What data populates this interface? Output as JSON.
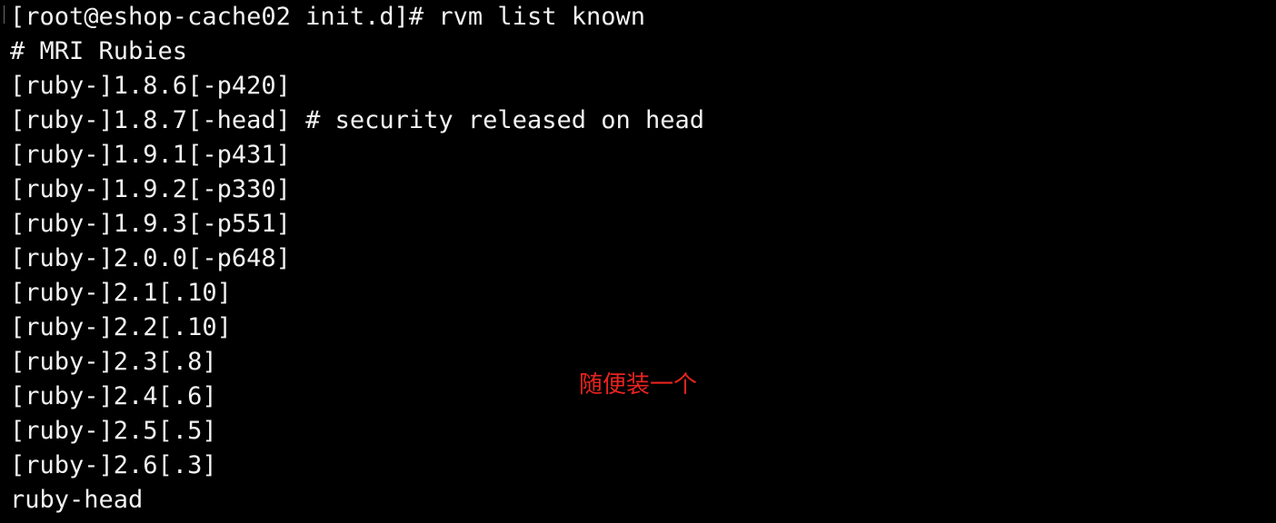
{
  "terminal": {
    "background": "#000000",
    "foreground": "#f2f2f2",
    "lines": [
      "[root@eshop-cache02 init.d]# rvm list known",
      "# MRI Rubies",
      "[ruby-]1.8.6[-p420]",
      "[ruby-]1.8.7[-head] # security released on head",
      "[ruby-]1.9.1[-p431]",
      "[ruby-]1.9.2[-p330]",
      "[ruby-]1.9.3[-p551]",
      "[ruby-]2.0.0[-p648]",
      "[ruby-]2.1[.10]",
      "[ruby-]2.2[.10]",
      "[ruby-]2.3[.8]",
      "[ruby-]2.4[.6]",
      "[ruby-]2.5[.5]",
      "[ruby-]2.6[.3]",
      "ruby-head"
    ]
  },
  "annotation": {
    "text": "随便装一个",
    "color": "#e8231e"
  }
}
